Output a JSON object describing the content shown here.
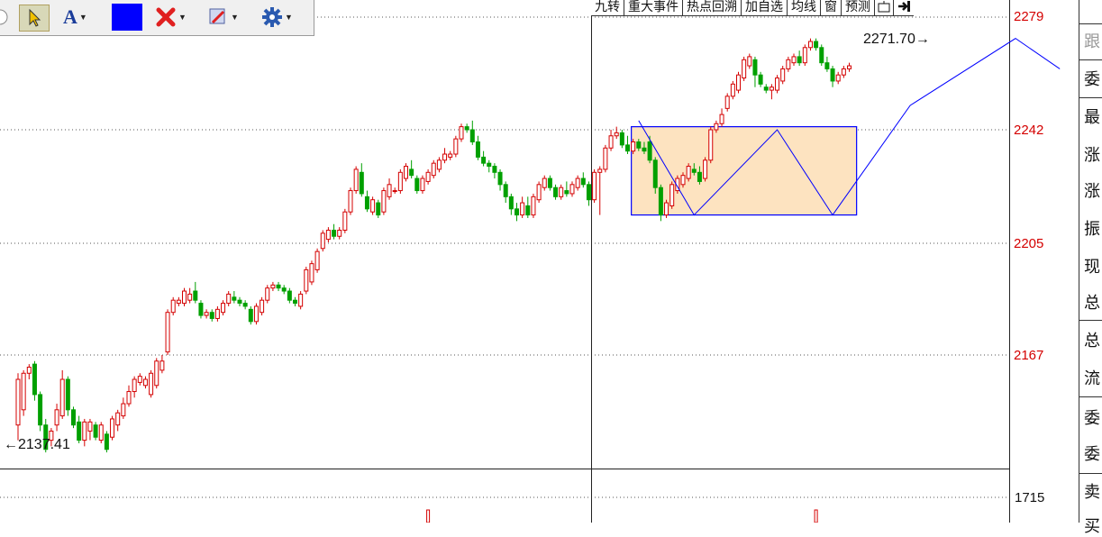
{
  "toolbar": {
    "items": [
      {
        "icon": "pointer-select-icon"
      },
      {
        "icon": "text-tool-icon",
        "label": "A"
      },
      {
        "icon": "color-swatch-icon",
        "color": "#0000ff"
      },
      {
        "icon": "delete-x-icon"
      },
      {
        "icon": "drawing-tool-icon"
      },
      {
        "icon": "gear-icon"
      }
    ]
  },
  "tabs": [
    "九转",
    "重大事件",
    "热点回溯",
    "加自选",
    "均线",
    "窗",
    "预测"
  ],
  "right_panel": {
    "labels": [
      "跟",
      "委",
      "最",
      "涨",
      "涨",
      "振",
      "现",
      "总",
      "总",
      "流",
      "委",
      "委",
      "卖",
      "买"
    ]
  },
  "colors": {
    "up": "#d40000",
    "down": "#00a000",
    "box_fill": "#fde3c0",
    "box_border": "#0000ff",
    "trend": "#0000ff"
  },
  "chart_data": {
    "type": "candlestick",
    "y_ticks": [
      "2279",
      "2242",
      "2205",
      "2167"
    ],
    "ylim": [
      2124,
      2280
    ],
    "volume_tick": "1715",
    "low_label": "2137.41",
    "high_label": "2271.70",
    "candles": [
      [
        2145,
        2160,
        2140,
        2162
      ],
      [
        2150,
        2162,
        2148,
        2163
      ],
      [
        2162,
        2164,
        2160,
        2165
      ],
      [
        2165,
        2155,
        2153,
        2166
      ],
      [
        2155,
        2145,
        2143,
        2156
      ],
      [
        2145,
        2137,
        2136,
        2147
      ],
      [
        2140,
        2143,
        2138,
        2144
      ],
      [
        2145,
        2150,
        2143,
        2152
      ],
      [
        2148,
        2160,
        2147,
        2163
      ],
      [
        2160,
        2150,
        2148,
        2161
      ],
      [
        2150,
        2145,
        2144,
        2151
      ],
      [
        2146,
        2140,
        2139,
        2148
      ],
      [
        2140,
        2146,
        2138,
        2147
      ],
      [
        2143,
        2146,
        2140,
        2147
      ],
      [
        2145,
        2141,
        2140,
        2146
      ],
      [
        2140,
        2145,
        2139,
        2146
      ],
      [
        2142,
        2137,
        2136,
        2143
      ],
      [
        2141,
        2147,
        2140,
        2148
      ],
      [
        2145,
        2149,
        2143,
        2150
      ],
      [
        2148,
        2152,
        2147,
        2154
      ],
      [
        2152,
        2156,
        2151,
        2158
      ],
      [
        2156,
        2160,
        2154,
        2161
      ],
      [
        2159,
        2161,
        2158,
        2162
      ],
      [
        2158,
        2160,
        2157,
        2161
      ],
      [
        2155,
        2162,
        2154,
        2163
      ],
      [
        2158,
        2166,
        2157,
        2167
      ],
      [
        2163,
        2166,
        2162,
        2168
      ],
      [
        2169,
        2182,
        2168,
        2183
      ],
      [
        2182,
        2186,
        2181,
        2187
      ],
      [
        2185,
        2186,
        2184,
        2187
      ],
      [
        2185,
        2189,
        2184,
        2190
      ],
      [
        2186,
        2188,
        2185,
        2190
      ],
      [
        2189,
        2186,
        2185,
        2192
      ],
      [
        2185,
        2181,
        2180,
        2186
      ],
      [
        2181,
        2182,
        2180,
        2183
      ],
      [
        2182,
        2180,
        2179,
        2183
      ],
      [
        2180,
        2183,
        2179,
        2184
      ],
      [
        2182,
        2185,
        2181,
        2186
      ],
      [
        2185,
        2188,
        2184,
        2189
      ],
      [
        2187,
        2186,
        2185,
        2189
      ],
      [
        2186,
        2185,
        2184,
        2187
      ],
      [
        2185,
        2184,
        2183,
        2186
      ],
      [
        2183,
        2179,
        2178,
        2184
      ],
      [
        2179,
        2184,
        2178,
        2185
      ],
      [
        2182,
        2186,
        2181,
        2187
      ],
      [
        2186,
        2190,
        2185,
        2191
      ],
      [
        2190,
        2191,
        2189,
        2192
      ],
      [
        2191,
        2190,
        2189,
        2192
      ],
      [
        2190,
        2189,
        2188,
        2191
      ],
      [
        2189,
        2186,
        2185,
        2190
      ],
      [
        2186,
        2185,
        2184,
        2187
      ],
      [
        2184,
        2188,
        2183,
        2189
      ],
      [
        2189,
        2196,
        2188,
        2197
      ],
      [
        2192,
        2198,
        2191,
        2199
      ],
      [
        2196,
        2202,
        2195,
        2203
      ],
      [
        2203,
        2208,
        2202,
        2209
      ],
      [
        2206,
        2209,
        2205,
        2210
      ],
      [
        2209,
        2207,
        2206,
        2211
      ],
      [
        2207,
        2209,
        2206,
        2210
      ],
      [
        2209,
        2215,
        2208,
        2216
      ],
      [
        2215,
        2222,
        2214,
        2223
      ],
      [
        2222,
        2229,
        2221,
        2230
      ],
      [
        2228,
        2221,
        2220,
        2231
      ],
      [
        2220,
        2216,
        2215,
        2222
      ],
      [
        2215,
        2219,
        2214,
        2220
      ],
      [
        2218,
        2214,
        2213,
        2219
      ],
      [
        2215,
        2222,
        2214,
        2223
      ],
      [
        2220,
        2224,
        2219,
        2226
      ],
      [
        2222,
        2222,
        2221,
        2223
      ],
      [
        2222,
        2228,
        2221,
        2229
      ],
      [
        2226,
        2230,
        2225,
        2231
      ],
      [
        2229,
        2227,
        2226,
        2232
      ],
      [
        2226,
        2222,
        2221,
        2227
      ],
      [
        2222,
        2226,
        2221,
        2227
      ],
      [
        2225,
        2228,
        2224,
        2229
      ],
      [
        2227,
        2231,
        2226,
        2232
      ],
      [
        2229,
        2232,
        2228,
        2233
      ],
      [
        2232,
        2234,
        2231,
        2236
      ],
      [
        2233,
        2234,
        2232,
        2235
      ],
      [
        2234,
        2239,
        2233,
        2240
      ],
      [
        2239,
        2243,
        2238,
        2244
      ],
      [
        2243,
        2242,
        2241,
        2244
      ],
      [
        2242,
        2238,
        2237,
        2245
      ],
      [
        2238,
        2233,
        2232,
        2240
      ],
      [
        2233,
        2231,
        2230,
        2235
      ],
      [
        2231,
        2230,
        2228,
        2232
      ],
      [
        2230,
        2228,
        2226,
        2231
      ],
      [
        2228,
        2224,
        2222,
        2229
      ],
      [
        2224,
        2220,
        2218,
        2225
      ],
      [
        2220,
        2216,
        2214,
        2221
      ],
      [
        2216,
        2214,
        2212,
        2218
      ],
      [
        2214,
        2218,
        2213,
        2220
      ],
      [
        2217,
        2214,
        2213,
        2220
      ],
      [
        2214,
        2220,
        2213,
        2221
      ],
      [
        2219,
        2224,
        2218,
        2225
      ],
      [
        2223,
        2226,
        2222,
        2227
      ],
      [
        2226,
        2223,
        2222,
        2227
      ],
      [
        2223,
        2220,
        2219,
        2224
      ],
      [
        2220,
        2223,
        2219,
        2224
      ],
      [
        2222,
        2221,
        2220,
        2225
      ],
      [
        2221,
        2224,
        2220,
        2225
      ],
      [
        2223,
        2226,
        2222,
        2227
      ],
      [
        2226,
        2224,
        2223,
        2228
      ],
      [
        2224,
        2219,
        2217,
        2225
      ],
      [
        2219,
        2228,
        2218,
        2229
      ],
      [
        2228,
        2229,
        2214,
        2230
      ],
      [
        2229,
        2236,
        2228,
        2237
      ],
      [
        2236,
        2240,
        2235,
        2242
      ],
      [
        2240,
        2241,
        2239,
        2243
      ],
      [
        2241,
        2237,
        2236,
        2242
      ],
      [
        2237,
        2235,
        2234,
        2240
      ],
      [
        2235,
        2238,
        2234,
        2239
      ],
      [
        2238,
        2236,
        2235,
        2239
      ],
      [
        2236,
        2235,
        2234,
        2238
      ],
      [
        2238,
        2232,
        2231,
        2240
      ],
      [
        2232,
        2223,
        2221,
        2233
      ],
      [
        2223,
        2214,
        2212,
        2224
      ],
      [
        2214,
        2218,
        2213,
        2219
      ],
      [
        2217,
        2224,
        2216,
        2225
      ],
      [
        2222,
        2226,
        2221,
        2227
      ],
      [
        2224,
        2227,
        2223,
        2228
      ],
      [
        2226,
        2230,
        2225,
        2231
      ],
      [
        2229,
        2228,
        2227,
        2231
      ],
      [
        2228,
        2225,
        2224,
        2230
      ],
      [
        2226,
        2232,
        2225,
        2233
      ],
      [
        2232,
        2242,
        2231,
        2243
      ],
      [
        2242,
        2244,
        2241,
        2245
      ],
      [
        2244,
        2247,
        2243,
        2249
      ],
      [
        2249,
        2253,
        2248,
        2254
      ],
      [
        2253,
        2257,
        2252,
        2258
      ],
      [
        2255,
        2260,
        2254,
        2261
      ],
      [
        2259,
        2265,
        2258,
        2266
      ],
      [
        2263,
        2266,
        2262,
        2267
      ],
      [
        2265,
        2260,
        2256,
        2266
      ],
      [
        2260,
        2257,
        2256,
        2261
      ],
      [
        2256,
        2255,
        2254,
        2257
      ],
      [
        2255,
        2256,
        2252,
        2257
      ],
      [
        2255,
        2259,
        2254,
        2260
      ],
      [
        2258,
        2262,
        2257,
        2263
      ],
      [
        2262,
        2265,
        2261,
        2266
      ],
      [
        2264,
        2266,
        2263,
        2267
      ],
      [
        2266,
        2264,
        2263,
        2268
      ],
      [
        2264,
        2269,
        2263,
        2270
      ],
      [
        2269,
        2271,
        2268,
        2272
      ],
      [
        2271,
        2269,
        2268,
        2272
      ],
      [
        2269,
        2264,
        2263,
        2270
      ],
      [
        2264,
        2262,
        2261,
        2266
      ],
      [
        2262,
        2258,
        2256,
        2263
      ],
      [
        2258,
        2260,
        2257,
        2261
      ],
      [
        2260,
        2262,
        2259,
        2263
      ],
      [
        2262,
        2263,
        2261,
        2264
      ]
    ],
    "box": {
      "x_start": 111,
      "x_end": 151,
      "y_low": 2214,
      "y_high": 2243
    },
    "trend_points": [
      [
        112,
        2245
      ],
      [
        122,
        2214
      ],
      [
        137,
        2242
      ],
      [
        147,
        2214
      ],
      [
        161,
        2250
      ],
      [
        180,
        2272
      ],
      [
        188,
        2262
      ]
    ],
    "volume_bars": [
      [
        74,
        1715
      ],
      [
        144,
        1715
      ]
    ]
  }
}
